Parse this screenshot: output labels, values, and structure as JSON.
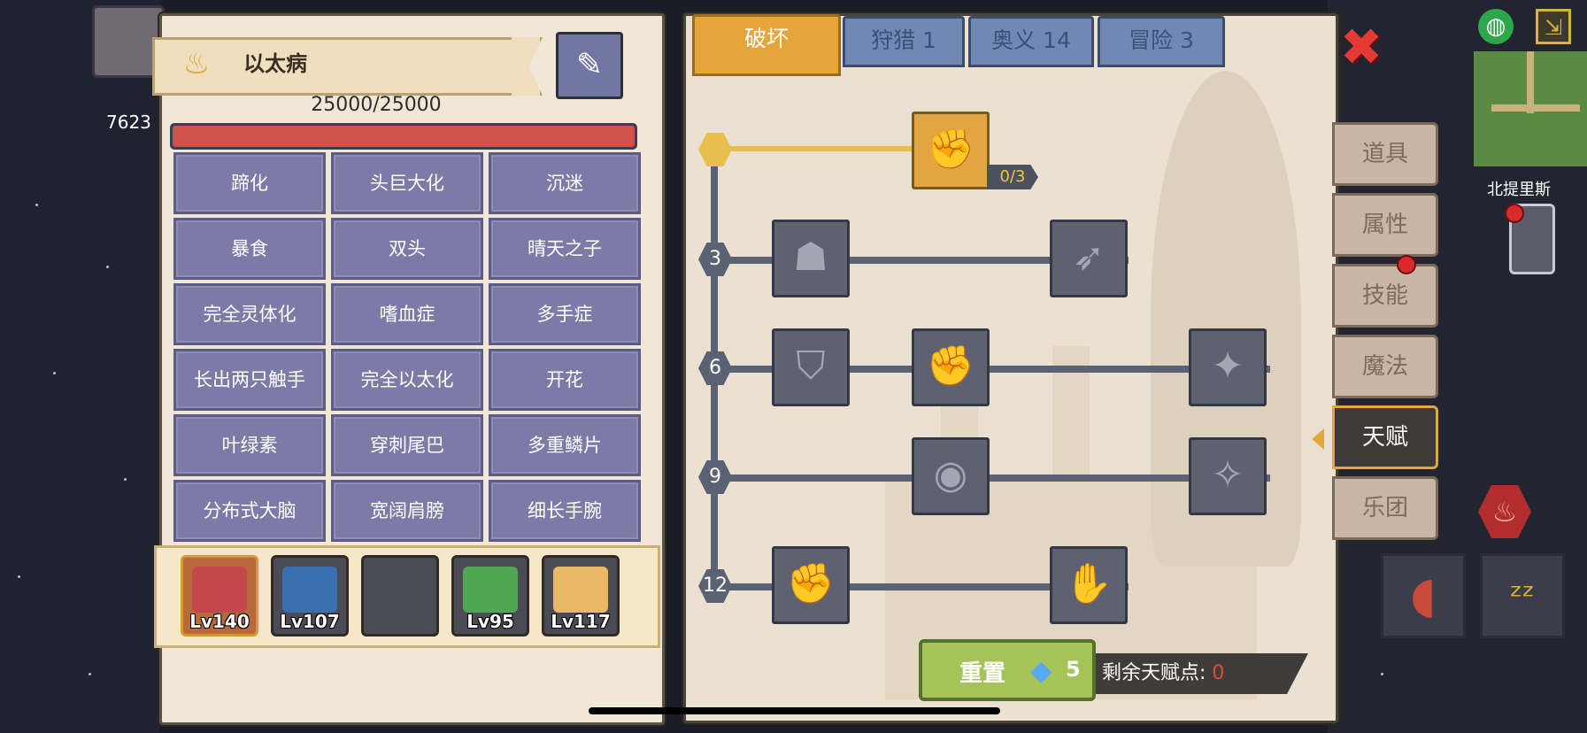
{
  "background": {
    "npc_name": "北提里斯",
    "coin_count": "7623"
  },
  "disease_panel": {
    "title": "以太病",
    "hp_text": "25000/25000",
    "hp_ratio": 1.0,
    "traits": [
      "蹄化",
      "头巨大化",
      "沉迷",
      "暴食",
      "双头",
      "晴天之子",
      "完全灵体化",
      "嗜血症",
      "多手症",
      "长出两只触手",
      "完全以太化",
      "开花",
      "叶绿素",
      "穿刺尾巴",
      "多重鳞片",
      "分布式大脑",
      "宽阔肩膀",
      "细长手腕"
    ]
  },
  "team": [
    {
      "level": "Lv140",
      "selected": true,
      "color": "#c2484b"
    },
    {
      "level": "Lv107",
      "selected": false,
      "color": "#3a6fb0"
    },
    {
      "level": "",
      "selected": false,
      "color": "#4b4b55"
    },
    {
      "level": "Lv95",
      "selected": false,
      "color": "#4fa653"
    },
    {
      "level": "Lv117",
      "selected": false,
      "color": "#e8b864"
    }
  ],
  "tabs": [
    {
      "label": "破坏",
      "active": true
    },
    {
      "label": "狩猎 1",
      "active": false
    },
    {
      "label": "奥义 14",
      "active": false
    },
    {
      "label": "冒险 3",
      "active": false
    }
  ],
  "talent_tree": {
    "top_node_icon": "handshake-icon",
    "top_node_count": "0/3",
    "levels": [
      "3",
      "6",
      "9",
      "12"
    ],
    "nodes": [
      {
        "name": "muscle-body-icon",
        "glyph": "☗"
      },
      {
        "name": "arrow-strike-icon",
        "glyph": "➶"
      },
      {
        "name": "shield-break-icon",
        "glyph": "⛉"
      },
      {
        "name": "power-fist-icon",
        "glyph": "✊"
      },
      {
        "name": "blade-splash-icon",
        "glyph": "✦"
      },
      {
        "name": "ground-slam-icon",
        "glyph": "◉"
      },
      {
        "name": "winged-drop-icon",
        "glyph": "✧"
      },
      {
        "name": "raised-fist-icon",
        "glyph": "✊"
      },
      {
        "name": "fist-block-icon",
        "glyph": "✋"
      }
    ]
  },
  "reset_button": {
    "label": "重置",
    "cost": "5",
    "currency_icon": "diamond-icon"
  },
  "talent_points": {
    "label": "剩余天赋点:",
    "value": "0"
  },
  "side_menu": [
    {
      "label": "道具",
      "active": false
    },
    {
      "label": "属性",
      "active": false
    },
    {
      "label": "技能",
      "active": false,
      "notify": true
    },
    {
      "label": "魔法",
      "active": false
    },
    {
      "label": "天赋",
      "active": true
    },
    {
      "label": "乐团",
      "active": false
    }
  ],
  "colors": {
    "accent_gold": "#e4a63a",
    "tab_blue": "#7188b5",
    "trait_purple": "#7b7ba8",
    "hp_red": "#d0524a",
    "reset_green": "#a5c356",
    "close_red": "#e43a34"
  }
}
